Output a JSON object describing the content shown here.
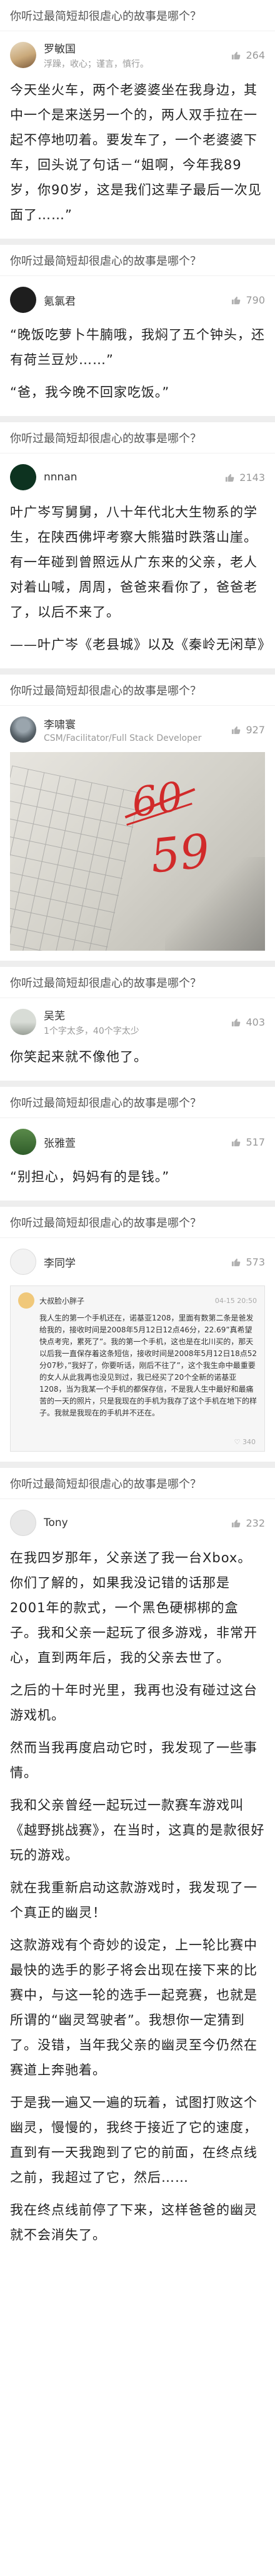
{
  "question": "你听过最简短却很虐心的故事是哪个？",
  "answers": [
    {
      "author": "罗敏国",
      "bio": "浮躁，收心；谨言，慎行。",
      "votes": "264",
      "paragraphs": [
        "今天坐火车，两个老婆婆坐在我身边，其中一个是来送另一个的，两人双手拉在一起不停地叨着。要发车了，一个老婆婆下车，回头说了句话－“姐啊，今年我89岁，你90岁，这是我们这辈子最后一次见面了……”"
      ]
    },
    {
      "author": "氪氯君",
      "bio": "",
      "votes": "790",
      "paragraphs": [
        "“晚饭吃萝卜牛腩哦，我焖了五个钟头，还有荷兰豆炒……”",
        "“爸，我今晚不回家吃饭。”"
      ]
    },
    {
      "author": "nnnan",
      "bio": "",
      "votes": "2143",
      "paragraphs": [
        "叶广岑写舅舅，八十年代北大生物系的学生，在陕西佛坪考察大熊猫时跌落山崖。有一年碰到曾照远从广东来的父亲，老人对着山喊，周周，爸爸来看你了，爸爸老了，以后不来了。",
        "——叶广岑《老县城》以及《秦岭无闲草》"
      ]
    },
    {
      "author": "李啸寰",
      "bio": "CSM/Facilitator/Full Stack Developer",
      "votes": "927",
      "photo": {
        "old_score": "60",
        "new_score": "59"
      }
    },
    {
      "author": "吴芜",
      "bio": "1个字太多，40个字太少",
      "votes": "403",
      "paragraphs": [
        "你笑起来就不像他了。"
      ]
    },
    {
      "author": "张雅萱",
      "bio": "",
      "votes": "517",
      "paragraphs": [
        "“别担心，妈妈有的是钱。”"
      ]
    },
    {
      "author": "李同学",
      "bio": "",
      "votes": "573",
      "shot": {
        "name": "大叔脸小胖子",
        "time": "04-15 20:50",
        "text": "我人生的第一个手机还在，诺基亚1208，里面有数第二条是爸发给我的，接收时间是2008年5月12日12点46分，22.69”真希望快点考完，累死了”。我的第一个手机，这也是在北川买的，那天以后我一直保存着这条短信，接收时间是2008年5月12日18点52分07秒，”我好了，你要听话，刚后不往了”，这个我生命中最重要的女人从此我再也没见到过，我已经买了20个全新的诺基亚1208，当为我某一个手机的都保存信，不是我人生中最好和最痛苦的一天的照片，只是我现在的手机为我存了这个手机在地下的样子。我就是我现在的手机并不还在。",
        "likes": "340"
      }
    },
    {
      "author": "Tony",
      "bio": "",
      "votes": "232",
      "paragraphs": [
        "在我四岁那年，父亲送了我一台Xbox。你们了解的，如果我没记错的话那是2001年的款式，一个黑色硬梆梆的盒子。我和父亲一起玩了很多游戏，非常开心，直到两年后，我的父亲去世了。",
        "之后的十年时光里，我再也没有碰过这台游戏机。",
        "然而当我再度启动它时，我发现了一些事情。",
        "我和父亲曾经一起玩过一款赛车游戏叫《越野挑战赛》，在当时，这真的是款很好玩的游戏。",
        "就在我重新启动这款游戏时，我发现了一个真正的幽灵！",
        "这款游戏有个奇妙的设定，上一轮比赛中最快的选手的影子将会出现在接下来的比赛中，与这一轮的选手一起竞赛，也就是所谓的“幽灵驾驶者”。我想你一定猜到了。没错，当年我父亲的幽灵至今仍然在赛道上奔驰着。",
        "于是我一遍又一遍的玩着，试图打败这个幽灵，慢慢的，我终于接近了它的速度，直到有一天我跑到了它的前面，在终点线之前，我超过了它，然后……",
        "我在终点线前停了下来，这样爸爸的幽灵就不会消失了。"
      ]
    }
  ]
}
